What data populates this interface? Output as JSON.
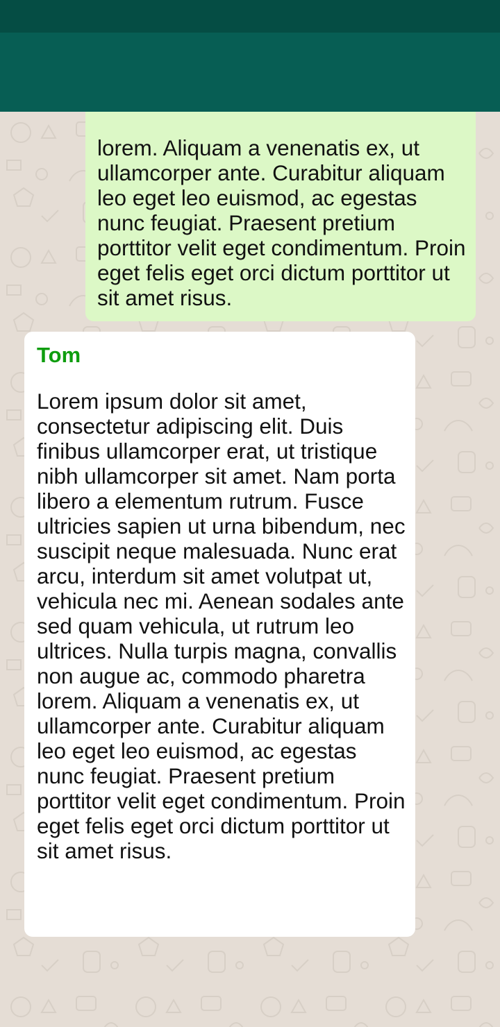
{
  "colors": {
    "status_bar": "#054d44",
    "app_bar": "#075e54",
    "chat_background": "#e5ddd5",
    "outgoing_bubble": "#dcf8c6",
    "incoming_bubble": "#ffffff",
    "sender_name": "#0f9d0f"
  },
  "messages": {
    "outgoing": {
      "text": "lorem. Aliquam a venenatis ex, ut ullamcorper ante. Curabitur aliquam leo eget leo euismod, ac egestas nunc feugiat. Praesent pretium porttitor velit eget condimentum. Proin eget felis eget orci dictum porttitor ut sit amet risus."
    },
    "incoming": {
      "sender": "Tom",
      "text": "Lorem ipsum dolor sit amet, consectetur adipiscing elit. Duis finibus ullamcorper erat, ut tristique nibh ullamcorper sit amet. Nam porta libero a elementum rutrum. Fusce ultricies sapien ut urna bibendum, nec suscipit neque malesuada. Nunc erat arcu, interdum sit amet volutpat ut, vehicula nec mi. Aenean sodales ante sed quam vehicula, ut rutrum leo ultrices. Nulla turpis magna, convallis non augue ac, commodo pharetra lorem. Aliquam a venenatis ex, ut ullamcorper ante. Curabitur aliquam leo eget leo euismod, ac egestas nunc feugiat. Praesent pretium porttitor velit eget condimentum. Proin eget felis eget orci dictum porttitor ut sit amet risus."
    }
  }
}
